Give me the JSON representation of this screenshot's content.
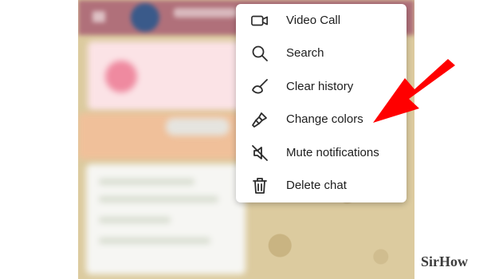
{
  "colors": {
    "menu_bg": "#ffffff",
    "menu_text": "#1d1d1d",
    "icon": "#2b2b2b",
    "header": "#b0707a",
    "chat_bg": "#dccb9f",
    "arrow": "#ff0000"
  },
  "menu": {
    "items": [
      {
        "label": "Video Call",
        "icon": "video-camera-icon"
      },
      {
        "label": "Search",
        "icon": "search-icon"
      },
      {
        "label": "Clear history",
        "icon": "broom-icon"
      },
      {
        "label": "Change colors",
        "icon": "paint-brush-icon"
      },
      {
        "label": "Mute notifications",
        "icon": "mute-speaker-icon"
      },
      {
        "label": "Delete chat",
        "icon": "trash-icon"
      }
    ]
  },
  "watermark": "SirHow"
}
